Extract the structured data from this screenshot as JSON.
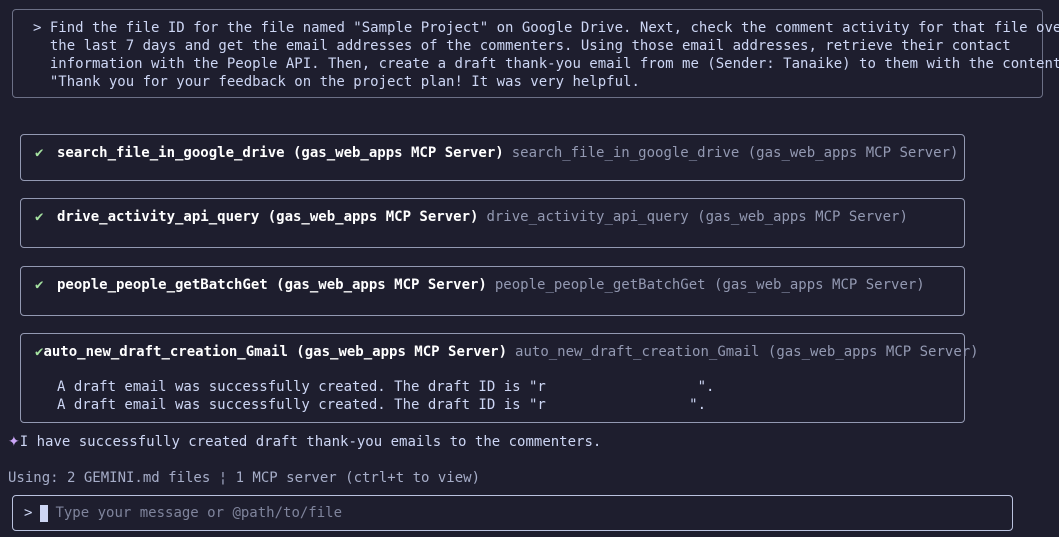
{
  "prompt": {
    "marker": ">",
    "lines": [
      "Find the file ID for the file named \"Sample Project\" on Google Drive. Next, check the comment activity for that file over",
      "the last 7 days and get the email addresses of the commenters. Using those email addresses, retrieve their contact",
      "information with the People API. Then, create a draft thank-you email from me (Sender: Tanaike) to them with the content:",
      "\"Thank you for your feedback on the project plan! It was very helpful."
    ]
  },
  "tool_calls": [
    {
      "status_icon": "✔",
      "name": "search_file_in_google_drive (gas_web_apps MCP Server)",
      "description": "search_file_in_google_drive (gas_web_apps MCP Server)",
      "output": []
    },
    {
      "status_icon": "✔",
      "name": "drive_activity_api_query (gas_web_apps MCP Server)",
      "description": "drive_activity_api_query (gas_web_apps MCP Server)",
      "output": []
    },
    {
      "status_icon": "✔",
      "name": "people_people_getBatchGet (gas_web_apps MCP Server)",
      "description": "people_people_getBatchGet (gas_web_apps MCP Server)",
      "output": []
    },
    {
      "status_icon": "✔",
      "name": "auto_new_draft_creation_Gmail (gas_web_apps MCP Server)",
      "description": "auto_new_draft_creation_Gmail (gas_web_apps MCP Server)",
      "output": [
        "A draft email was successfully created. The draft ID is \"r                  \".",
        "A draft email was successfully created. The draft ID is \"r                 \"."
      ]
    }
  ],
  "response": {
    "icon": "✦",
    "text": "I have successfully created draft thank-you emails to the commenters."
  },
  "status_line": "Using: 2 GEMINI.md files ¦ 1 MCP server (ctrl+t to view)",
  "input": {
    "marker": ">",
    "placeholder": "Type your message or @path/to/file"
  },
  "colors": {
    "background": "#1e1e2e",
    "success": "#a6e3a1",
    "accent": "#cba6f7",
    "muted": "#9399b2"
  }
}
